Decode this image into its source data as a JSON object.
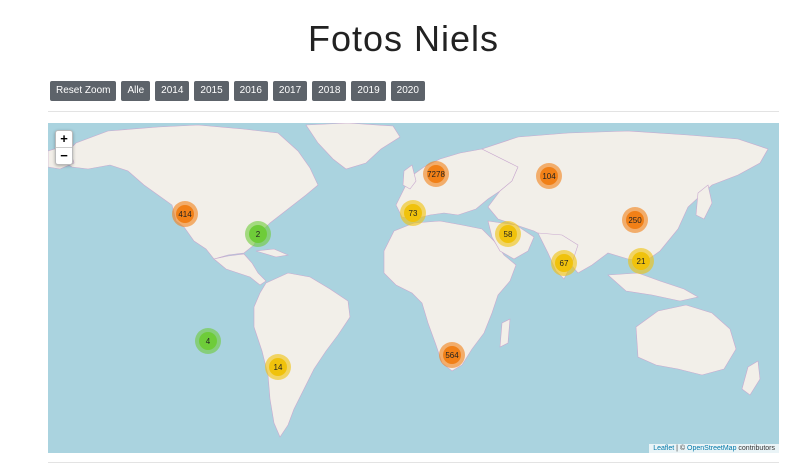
{
  "title": "Fotos Niels",
  "toolbar": {
    "buttons": [
      "Reset Zoom",
      "Alle",
      "2014",
      "2015",
      "2016",
      "2017",
      "2018",
      "2019",
      "2020"
    ]
  },
  "map": {
    "zoom_in": "+",
    "zoom_out": "−",
    "attribution": {
      "leaflet": "Leaflet",
      "separator": " | © ",
      "osm": "OpenStreetMap",
      "suffix": " contributors"
    },
    "clusters": [
      {
        "count": "7278",
        "level": "large"
      },
      {
        "count": "104",
        "level": "large"
      },
      {
        "count": "414",
        "level": "large"
      },
      {
        "count": "73",
        "level": "medium"
      },
      {
        "count": "58",
        "level": "medium"
      },
      {
        "count": "250",
        "level": "large"
      },
      {
        "count": "2",
        "level": "small"
      },
      {
        "count": "67",
        "level": "medium"
      },
      {
        "count": "21",
        "level": "medium"
      },
      {
        "count": "4",
        "level": "small"
      },
      {
        "count": "14",
        "level": "medium"
      },
      {
        "count": "564",
        "level": "large"
      }
    ],
    "colors": {
      "water": "#aad3df",
      "land": "#f2efe9",
      "border": "#c9a9cf",
      "small": "#6ecc39",
      "medium": "#f0c20c",
      "large": "#f18017"
    }
  }
}
